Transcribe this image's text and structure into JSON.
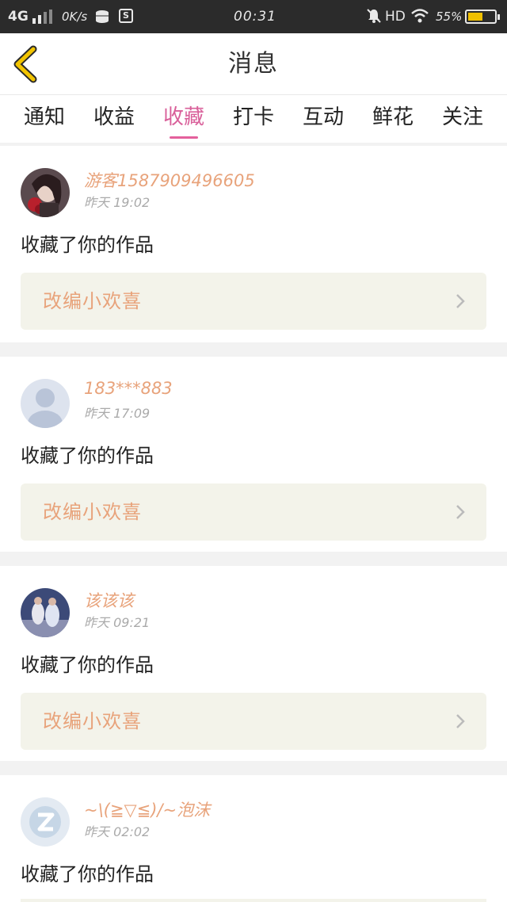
{
  "status_bar": {
    "network": "4G",
    "speed": "0K/s",
    "sim_icon": "S",
    "time": "00:31",
    "hd": "HD",
    "battery": "55%",
    "battery_level": 0.55
  },
  "nav": {
    "title": "消息"
  },
  "tabs": [
    {
      "label": "通知"
    },
    {
      "label": "收益"
    },
    {
      "label": "收藏"
    },
    {
      "label": "打卡"
    },
    {
      "label": "互动"
    },
    {
      "label": "鲜花"
    },
    {
      "label": "关注"
    }
  ],
  "active_tab": "收藏",
  "messages": [
    {
      "name": "游客1587909496605",
      "time": "昨天 19:02",
      "action": "收藏了你的作品",
      "work": "改编小欢喜",
      "avatar": "portrait-avatar"
    },
    {
      "name": "183***883",
      "time": "昨天 17:09",
      "action": "收藏了你的作品",
      "work": "改编小欢喜",
      "avatar": "default-user-avatar"
    },
    {
      "name": "该该该",
      "time": "昨天 09:21",
      "action": "收藏了你的作品",
      "work": "改编小欢喜",
      "avatar": "photo-avatar"
    },
    {
      "name": "~\\(≧▽≦)/~泡沫",
      "time": "昨天 02:02",
      "action": "收藏了你的作品",
      "work": "",
      "avatar": "qq-avatar"
    }
  ],
  "colors": {
    "accent": "#e4609c",
    "username": "#e8a37b",
    "back_arrow": "#f2c400",
    "work_bg": "#f3f3ea"
  }
}
